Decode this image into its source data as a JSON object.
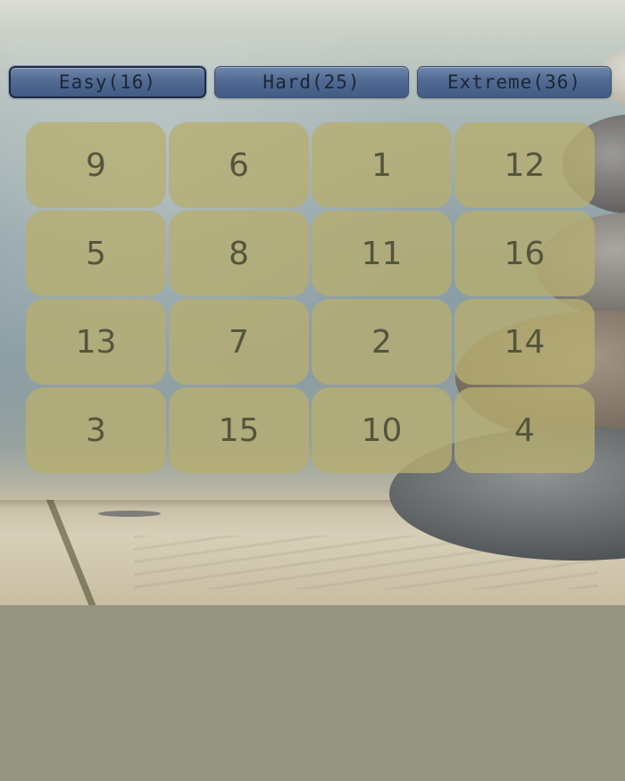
{
  "difficulty_buttons": [
    {
      "label": "Easy(16)",
      "selected": true
    },
    {
      "label": "Hard(25)",
      "selected": false
    },
    {
      "label": "Extreme(36)",
      "selected": false
    }
  ],
  "board": {
    "size": 4,
    "tiles": [
      "9",
      "6",
      "1",
      "12",
      "5",
      "8",
      "11",
      "16",
      "13",
      "7",
      "2",
      "14",
      "3",
      "15",
      "10",
      "4"
    ]
  },
  "colors": {
    "tile_fill": "#b7ae70",
    "tile_text": "#54553d",
    "button_blue": "#506a93",
    "bottom_area": "#959681"
  },
  "background_image": "zen stones stacked on wooden plank"
}
